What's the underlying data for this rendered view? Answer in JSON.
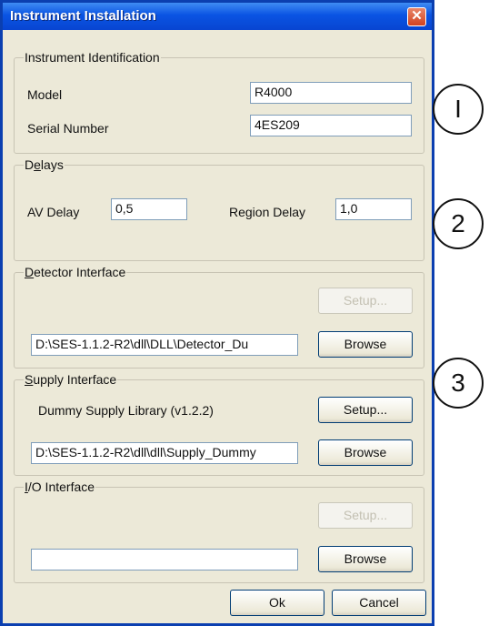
{
  "window": {
    "title": "Instrument Installation",
    "close_glyph": "✕"
  },
  "identification": {
    "group_label": "Instrument Identification",
    "model_label": "Model",
    "model_value": "R4000",
    "serial_label": "Serial Number",
    "serial_value": "4ES209"
  },
  "delays": {
    "group_label": "Delays",
    "av_label": "AV Delay",
    "av_value": "0,5",
    "region_label": "Region Delay",
    "region_value": "1,0"
  },
  "detector": {
    "group_label": "Detector Interface",
    "setup_label": "Setup...",
    "path_value": "D:\\SES-1.1.2-R2\\dll\\DLL\\Detector_Du",
    "browse_label": "Browse"
  },
  "supply": {
    "group_label": "Supply Interface",
    "library_text": "Dummy Supply Library (v1.2.2)",
    "setup_label": "Setup...",
    "path_value": "D:\\SES-1.1.2-R2\\dll\\dll\\Supply_Dummy",
    "browse_label": "Browse"
  },
  "io": {
    "group_label": "I/O Interface",
    "setup_label": "Setup...",
    "path_value": "",
    "browse_label": "Browse"
  },
  "footer": {
    "ok_label": "Ok",
    "cancel_label": "Cancel"
  },
  "annotations": [
    "I",
    "2",
    "3"
  ]
}
